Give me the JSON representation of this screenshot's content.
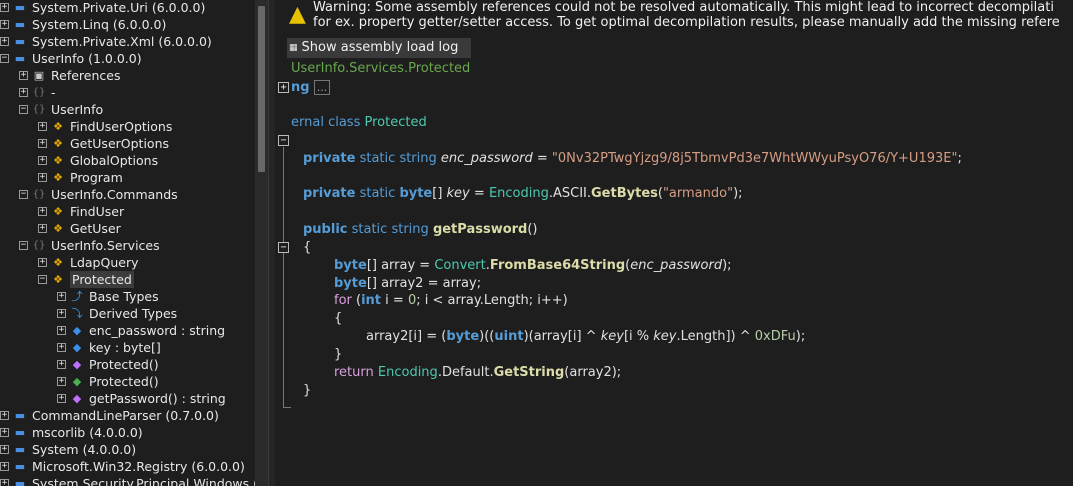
{
  "tree": {
    "items": [
      {
        "label": "System.Private.Uri (6.0.0.0)",
        "depth": 0,
        "exp": "+",
        "icon": "assembly-icon"
      },
      {
        "label": "System.Linq (6.0.0.0)",
        "depth": 0,
        "exp": "+",
        "icon": "assembly-icon"
      },
      {
        "label": "System.Private.Xml (6.0.0.0)",
        "depth": 0,
        "exp": "+",
        "icon": "assembly-icon"
      },
      {
        "label": "UserInfo (1.0.0.0)",
        "depth": 0,
        "exp": "-",
        "icon": "assembly-icon"
      },
      {
        "label": "References",
        "depth": 1,
        "exp": "+",
        "icon": "references-icon"
      },
      {
        "label": "-",
        "depth": 1,
        "exp": "+",
        "icon": "namespace-icon"
      },
      {
        "label": "UserInfo",
        "depth": 1,
        "exp": "-",
        "icon": "namespace-icon"
      },
      {
        "label": "FindUserOptions",
        "depth": 2,
        "exp": "+",
        "icon": "class-icon"
      },
      {
        "label": "GetUserOptions",
        "depth": 2,
        "exp": "+",
        "icon": "class-icon"
      },
      {
        "label": "GlobalOptions",
        "depth": 2,
        "exp": "+",
        "icon": "class-icon"
      },
      {
        "label": "Program",
        "depth": 2,
        "exp": "+",
        "icon": "class-icon"
      },
      {
        "label": "UserInfo.Commands",
        "depth": 1,
        "exp": "-",
        "icon": "namespace-icon"
      },
      {
        "label": "FindUser",
        "depth": 2,
        "exp": "+",
        "icon": "class-icon"
      },
      {
        "label": "GetUser",
        "depth": 2,
        "exp": "+",
        "icon": "class-icon"
      },
      {
        "label": "UserInfo.Services",
        "depth": 1,
        "exp": "-",
        "icon": "namespace-icon"
      },
      {
        "label": "LdapQuery",
        "depth": 2,
        "exp": "+",
        "icon": "class-icon"
      },
      {
        "label": "Protected",
        "depth": 2,
        "exp": "-",
        "icon": "class-icon",
        "selected": true
      },
      {
        "label": "Base Types",
        "depth": 3,
        "exp": "+",
        "icon": "base-types-icon"
      },
      {
        "label": "Derived Types",
        "depth": 3,
        "exp": "+",
        "icon": "derived-types-icon"
      },
      {
        "label": "enc_password : string",
        "depth": 3,
        "exp": "+",
        "icon": "field-icon"
      },
      {
        "label": "key : byte[]",
        "depth": 3,
        "exp": "+",
        "icon": "field-icon"
      },
      {
        "label": "Protected()",
        "depth": 3,
        "exp": "+",
        "icon": "constructor-icon"
      },
      {
        "label": "Protected()",
        "depth": 3,
        "exp": "+",
        "icon": "static-constructor-icon"
      },
      {
        "label": "getPassword() : string",
        "depth": 3,
        "exp": "+",
        "icon": "method-icon"
      },
      {
        "label": "CommandLineParser (0.7.0.0)",
        "depth": 0,
        "exp": "+",
        "icon": "assembly-icon"
      },
      {
        "label": "mscorlib (4.0.0.0)",
        "depth": 0,
        "exp": "+",
        "icon": "assembly-icon"
      },
      {
        "label": "System (4.0.0.0)",
        "depth": 0,
        "exp": "+",
        "icon": "assembly-icon"
      },
      {
        "label": "Microsoft.Win32.Registry (6.0.0.0)",
        "depth": 0,
        "exp": "+",
        "icon": "assembly-icon"
      },
      {
        "label": "System.Security.Principal.Windows (",
        "depth": 0,
        "exp": "+",
        "icon": "assembly-icon"
      }
    ]
  },
  "warning": {
    "icon": "warning-icon",
    "line1": "Warning: Some assembly references could not be resolved automatically. This might lead to incorrect decompilati",
    "line2": "for ex. property getter/setter access. To get optimal decompilation results, please manually add the missing refere"
  },
  "load_log_button": "Show assembly load log",
  "code": {
    "namespace_comment": "UserInfo.Services.Protected",
    "using_kw": "ng",
    "collapsed": "...",
    "class_line": {
      "kw1": "ernal",
      "kw2": "class",
      "name": "Protected"
    },
    "field1": {
      "mod": "private",
      "static": "static",
      "type": "string",
      "name": "enc_password",
      "eq": " = ",
      "value": "\"0Nv32PTwgYjzg9/8j5TbmvPd3e7WhtWWyuPsyO76/Y+U193E\"",
      "end": ";"
    },
    "field2": {
      "mod": "private",
      "static": "static",
      "type": "byte",
      "br": "[] ",
      "name": "key",
      "eq": " = ",
      "cls": "Encoding",
      "p1": ".ASCII.",
      "fn": "GetBytes",
      "arg": "\"armando\"",
      "end": ");"
    },
    "method": {
      "mod": "public",
      "static": "static",
      "type": "string",
      "name": "getPassword",
      "params": "()"
    },
    "open_brace": "{",
    "close_brace": "}",
    "stmt1": {
      "t": "byte",
      "r1": "[] array = ",
      "cls": "Convert",
      "dot": ".",
      "fn": "FromBase64String",
      "p": "(",
      "arg": "enc_password",
      "end": ");"
    },
    "stmt2": {
      "t": "byte",
      "r": "[] array2 = array;"
    },
    "stmt3": {
      "for": "for",
      "p1": " (",
      "int": "int",
      "p2": " i = ",
      "zero": "0",
      "p3": "; i < array.Length; i++)"
    },
    "stmt4": {
      "p1": "array2[i] = (",
      "byte": "byte",
      "p2": ")((",
      "uint": "uint",
      "p3": ")(array[i] ^ ",
      "key1": "key",
      "p4": "[i % ",
      "key2": "key",
      "p5": ".Length]) ^ ",
      "hex": "0xDFu",
      "end": ");"
    },
    "stmt5": {
      "ret": "return",
      "cls": "Encoding",
      "p1": ".Default.",
      "fn": "GetString",
      "end": "(array2);"
    }
  },
  "colors": {
    "keyword": "#569cd6",
    "type": "#4ec9b0",
    "string": "#d69d85",
    "method": "#dcdcaa",
    "control": "#d8a0df",
    "warning": "#e8c100"
  }
}
